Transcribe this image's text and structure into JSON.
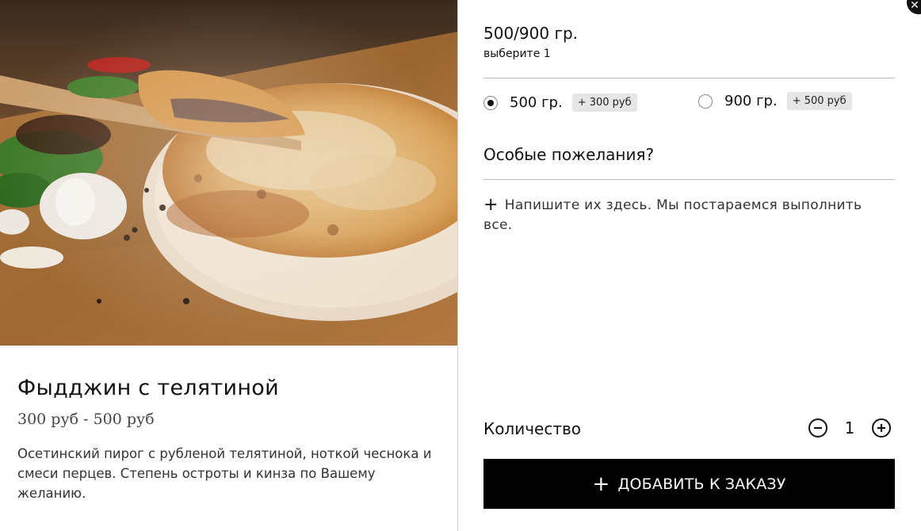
{
  "product": {
    "title": "Фыдджин с телятиной",
    "price_range": "300 руб - 500 руб",
    "description": "Осетинский пирог с рубленой телятиной, ноткой чеснока и смеси перцев. Степень остроты и кинза по Вашему желанию."
  },
  "options": {
    "group_title": "500/900 гр.",
    "hint": "выберите 1",
    "choices": [
      {
        "label": "500 гр.",
        "price": "+ 300 руб",
        "selected": true
      },
      {
        "label": "900 гр.",
        "price": "+ 500 руб",
        "selected": false
      }
    ]
  },
  "special_requests": {
    "title": "Особые пожелания?",
    "add_note": "Напишите их здесь. Мы постараемся выполнить все."
  },
  "quantity": {
    "label": "Количество",
    "value": "1"
  },
  "cart": {
    "add_label": "ДОБАВИТЬ К ЗАКАЗУ"
  },
  "icons": {
    "close": "close-icon",
    "plus": "plus-icon",
    "minus_circle": "minus-circle-icon",
    "plus_circle": "plus-circle-icon"
  },
  "colors": {
    "button_bg": "#000000",
    "button_text": "#ffffff",
    "price_tag_bg": "#e6e6e6",
    "divider": "#bdbdbd"
  }
}
